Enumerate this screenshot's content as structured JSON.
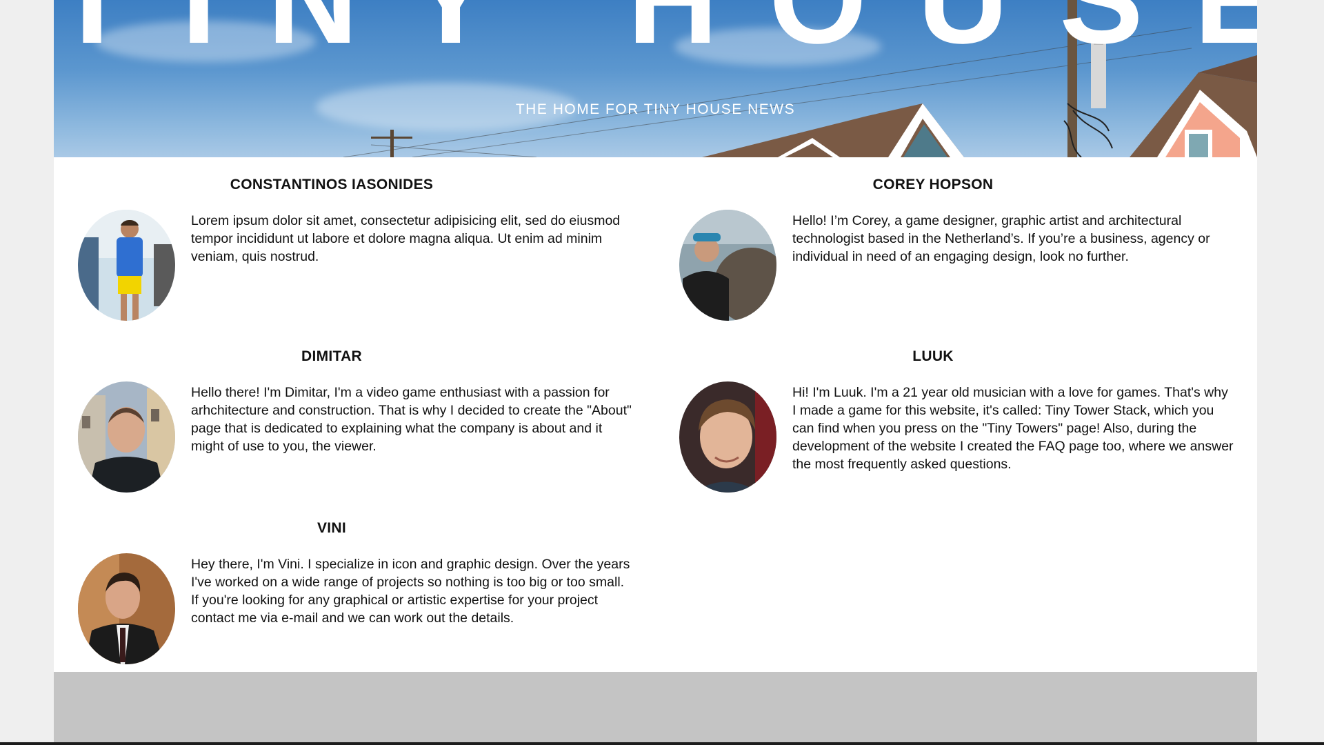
{
  "hero": {
    "title": "TINY HOUSES",
    "subtitle": "THE HOME FOR TINY HOUSE NEWS"
  },
  "members": [
    {
      "name": "CONSTANTINOS IASONIDES",
      "bio": "Lorem ipsum dolor sit amet, consectetur adipisicing elit, sed do eiusmod tempor incididunt ut labore et dolore magna aliqua. Ut enim ad minim veniam, quis nostrud."
    },
    {
      "name": "COREY HOPSON",
      "bio": "Hello! I’m Corey, a game designer, graphic artist and architectural technologist based in the Netherland’s. If you’re a business, agency or individual in need of an engaging design, look no further."
    },
    {
      "name": "DIMITAR",
      "bio": "Hello there! I'm Dimitar, I'm a video game enthusiast with a passion for arhchitecture and construction. That is why I decided to create the \"About\" page that is dedicated to explaining what the company is about and it might of use to you, the viewer."
    },
    {
      "name": "LUUK",
      "bio": "Hi! I'm Luuk. I'm a 21 year old musician with a love for games. That's why I made a game for this website, it's called: Tiny Tower Stack, which you can find when you press on the \"Tiny Towers\" page! Also, during the development of the website I created the FAQ page too, where we answer the most frequently asked questions."
    },
    {
      "name": "VINI",
      "bio": "Hey there, I'm Vini. I specialize in icon and graphic design. Over the years I've worked on a wide range of projects so nothing is too big or too small. If you're looking for any graphical or artistic expertise for your project contact me via e-mail and we can work out the details."
    }
  ],
  "colors": {
    "page_background": "#efefef",
    "content_background": "#ffffff",
    "footer_background": "#c4c4c4",
    "sky": "#4a88c8"
  }
}
